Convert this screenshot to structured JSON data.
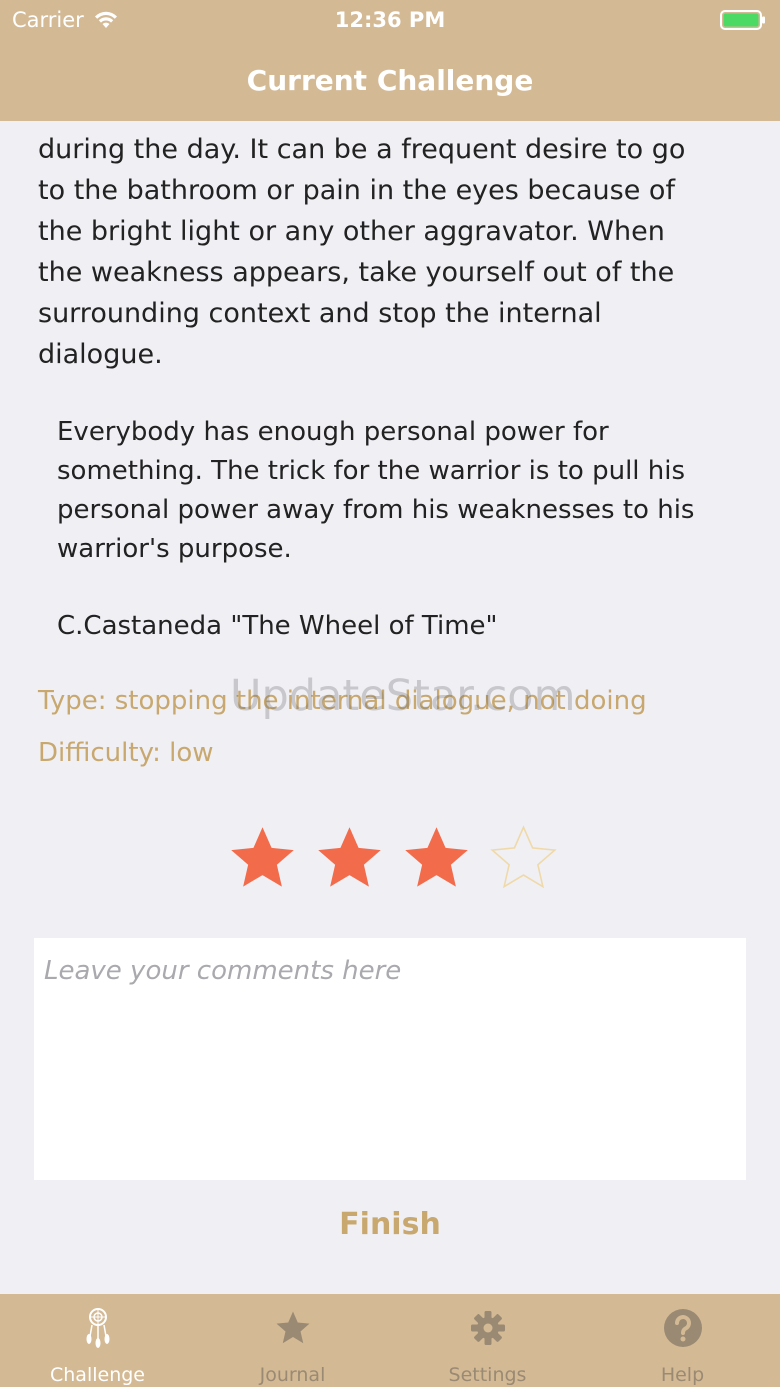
{
  "status": {
    "carrier": "Carrier",
    "time": "12:36 PM",
    "battery_color": "#4CD964"
  },
  "nav": {
    "title": "Current Challenge"
  },
  "body": {
    "lines": [
      "during the day. It can be a frequent desire to go",
      "to the bathroom or pain in the eyes because of",
      "the bright light or any other aggravator. When",
      "the weakness appears, take yourself out of the",
      "surrounding context and stop the internal",
      "dialogue."
    ]
  },
  "quote": {
    "lines": [
      "Everybody has enough personal power for",
      "something. The trick for the warrior is to pull his",
      "personal power away from his weaknesses to his",
      "warrior's purpose."
    ],
    "author": "C.Castaneda \"The Wheel of Time\""
  },
  "meta": {
    "type": "Type: stopping the internal dialogue, not doing",
    "difficulty": "Difficulty: low"
  },
  "watermark": "UpdateStar.com",
  "rating": {
    "value": 3,
    "max": 5,
    "filled_color": "#F26B4A",
    "empty_color": "#F0D9A8"
  },
  "comment": {
    "placeholder": "Leave your comments here",
    "value": ""
  },
  "finish_label": "Finish",
  "tabs": [
    {
      "label": "Challenge",
      "icon": "dreamcatcher-icon",
      "active": true
    },
    {
      "label": "Journal",
      "icon": "star-icon",
      "active": false
    },
    {
      "label": "Settings",
      "icon": "gear-icon",
      "active": false
    },
    {
      "label": "Help",
      "icon": "question-icon",
      "active": false
    }
  ],
  "colors": {
    "accent": "#D4B995",
    "text_accent": "#C8A86E",
    "tab_inactive": "#9a8a73"
  }
}
